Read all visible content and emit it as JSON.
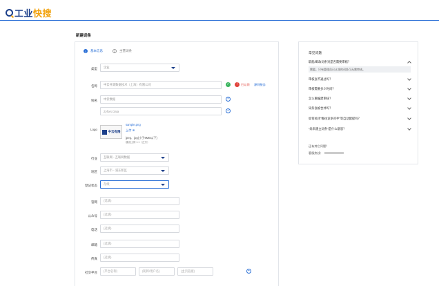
{
  "header": {
    "logo_text_a": "工业",
    "logo_text_b": "快搜"
  },
  "page_title": "新建词条",
  "steps": [
    {
      "num": "1",
      "label": "基本信息",
      "active": true
    },
    {
      "num": "2",
      "label": "主营词条",
      "active": false
    }
  ],
  "form": {
    "type_label": "类型",
    "type_value": "企业",
    "name_label": "名称",
    "name_value": "中云开源数据技术（上海）有限公司",
    "name_status": "已认领",
    "name_link": "源特服务",
    "alias_label": "别名",
    "alias_value_1": "中云数据",
    "alias_value_2": "Zyfors Data",
    "logo_label": "Logo",
    "logo_brand": "中云有限",
    "logo_file": "sample.png",
    "logo_upload": "上传",
    "logo_hint": "jpeg、jpg(小于6MB以下)",
    "logo_ratio": "建议比例 1:1（正方）",
    "industry_label": "行业",
    "industry_value": "互联网 - 互联网数据",
    "region_label": "地区",
    "region_value": "上海市 - 浦东新区",
    "reg_status_label": "登记状态",
    "reg_status_value": "存续",
    "website_label": "官网",
    "website_placeholder": "(选填)",
    "wechat_label": "公众号",
    "wechat_placeholder": "(选填)",
    "phone_label": "电话",
    "phone_placeholder": "(选填)",
    "email_label": "邮箱",
    "email_placeholder": "(选填)",
    "fax_label": "传真",
    "fax_placeholder": "(选填)",
    "social_label": "社交平台",
    "social_platform_placeholder": "(平台名称)",
    "social_account_placeholder": "(昵称/用户名)",
    "social_url_placeholder": "(主页链接)"
  },
  "faq": {
    "title": "常见问题",
    "items": [
      {
        "q": "职能/邮政词条对是否需要审核？",
        "expanded": true
      },
      {
        "q": "审核会不通过吗？",
        "expanded": false
      },
      {
        "q": "审核需要多少时间？",
        "expanded": false
      },
      {
        "q": "怎么重编建审核？",
        "expanded": false
      },
      {
        "q": "词条会被合并吗？",
        "expanded": false
      },
      {
        "q": "如何关闭“推往竞争对手”等自动配提吗？",
        "expanded": false
      },
      {
        "q": "“尚未建立词条”是什么意思？",
        "expanded": false
      }
    ],
    "answer": "需要。只有管理员已认领的词条可无需审核。",
    "more_label": "还有其它问题？",
    "hotline_label": "客服热线："
  },
  "colors": {
    "brand": "#1c3f8a",
    "accent": "#2a6fd6",
    "logo_accent": "#f2a20c",
    "success": "#3bb55f",
    "error": "#e0433b"
  }
}
